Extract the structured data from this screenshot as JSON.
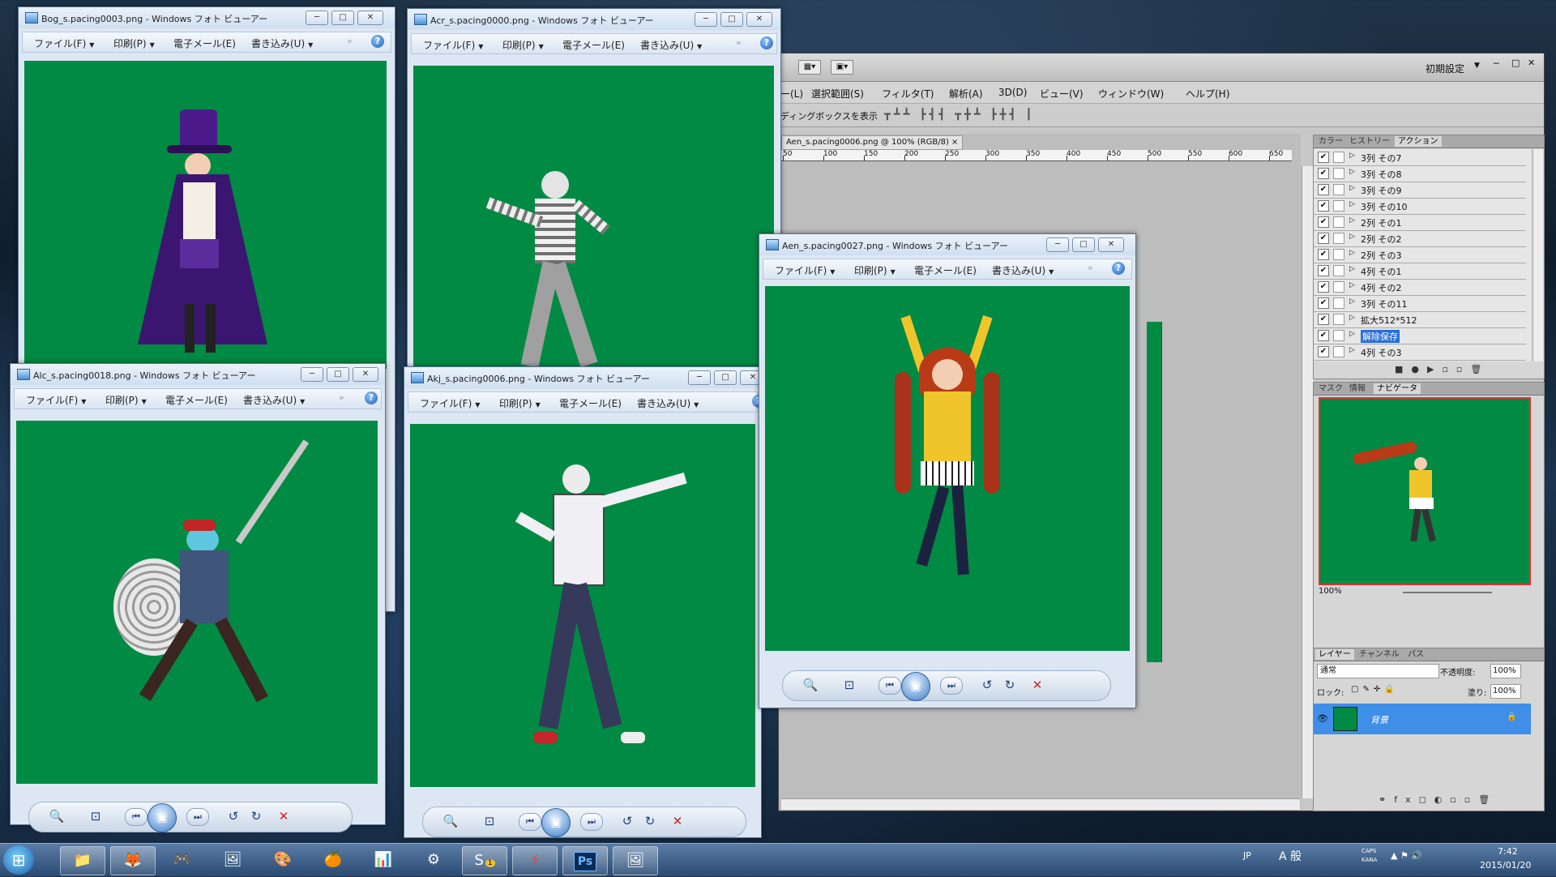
{
  "colors": {
    "chroma_green": "#008a43",
    "selection_blue": "#2a6fd8"
  },
  "viewer_common": {
    "menu": {
      "file": "ファイル(F)",
      "print": "印刷(P)",
      "email": "電子メール(E)",
      "burn": "書き込み(U)"
    },
    "more": "»",
    "help": "?",
    "minimize": "─",
    "maximize": "□",
    "close": "✕"
  },
  "viewers": [
    {
      "title": "Bog_s.pacing0003.png - Windows フォト ビューアー"
    },
    {
      "title": "Acr_s.pacing0000.png - Windows フォト ビューアー"
    },
    {
      "title": "Alc_s.pacing0018.png - Windows フォト ビューアー"
    },
    {
      "title": "Akj_s.pacing0006.png - Windows フォト ビューアー"
    },
    {
      "title": "Aen_s.pacing0027.png - Windows フォト ビューアー"
    }
  ],
  "viewer_toolbar_icons": [
    "zoom-icon",
    "fit-icon",
    "previous-icon",
    "slideshow-icon",
    "next-icon",
    "rotate-left-icon",
    "rotate-right-icon",
    "delete-icon"
  ],
  "photoshop": {
    "workspace_label": "初期設定",
    "menu": [
      "ー(L)",
      "選択範囲(S)",
      "フィルタ(T)",
      "解析(A)",
      "3D(D)",
      "ビュー(V)",
      "ウィンドウ(W)",
      "ヘルプ(H)"
    ],
    "options_label": "ディングボックスを表示",
    "doc_tab": "Aen_s.pacing0006.png @ 100% (RGB/8)",
    "doc_tab_close": "×",
    "ruler": [
      "50",
      "100",
      "150",
      "200",
      "250",
      "300",
      "350",
      "400",
      "450",
      "500",
      "550",
      "600",
      "650"
    ],
    "panel1_tabs": [
      "カラー",
      "ヒストリー",
      "アクション"
    ],
    "actions": [
      {
        "label": "3列 その7",
        "selected": false
      },
      {
        "label": "3列 その8",
        "selected": false
      },
      {
        "label": "3列 その9",
        "selected": false
      },
      {
        "label": "3列 その10",
        "selected": false
      },
      {
        "label": "2列 その1",
        "selected": false
      },
      {
        "label": "2列 その2",
        "selected": false
      },
      {
        "label": "2列 その3",
        "selected": false
      },
      {
        "label": "4列 その1",
        "selected": false
      },
      {
        "label": "4列 その2",
        "selected": false
      },
      {
        "label": "3列 その11",
        "selected": false
      },
      {
        "label": "拡大512*512",
        "selected": false
      },
      {
        "label": "解除保存",
        "selected": true
      },
      {
        "label": "4列 その3",
        "selected": false
      }
    ],
    "panel2_tabs": [
      "マスク",
      "情報",
      "ナビゲータ"
    ],
    "navigator_zoom": "100%",
    "panel3_tabs": [
      "レイヤー",
      "チャンネル",
      "パス"
    ],
    "blend_mode": "通常",
    "opacity_label": "不透明度:",
    "opacity_value": "100%",
    "lock_label": "ロック:",
    "fill_label": "塗り:",
    "fill_value": "100%",
    "layer_name": "背景"
  },
  "taskbar": {
    "start": "⊞",
    "apps": [
      "explorer",
      "firefox",
      "game-app",
      "anime-app",
      "paint",
      "orange-app",
      "score-app",
      "gear-app",
      "skype",
      "flash",
      "photoshop",
      "photo-viewer"
    ],
    "ps_label": "Ps",
    "skype_badge": "1",
    "tray": {
      "lang": "JP",
      "ime": "A 般",
      "caps": "CAPS",
      "kana": "KANA",
      "time": "7:42",
      "date": "2015/01/20"
    }
  }
}
